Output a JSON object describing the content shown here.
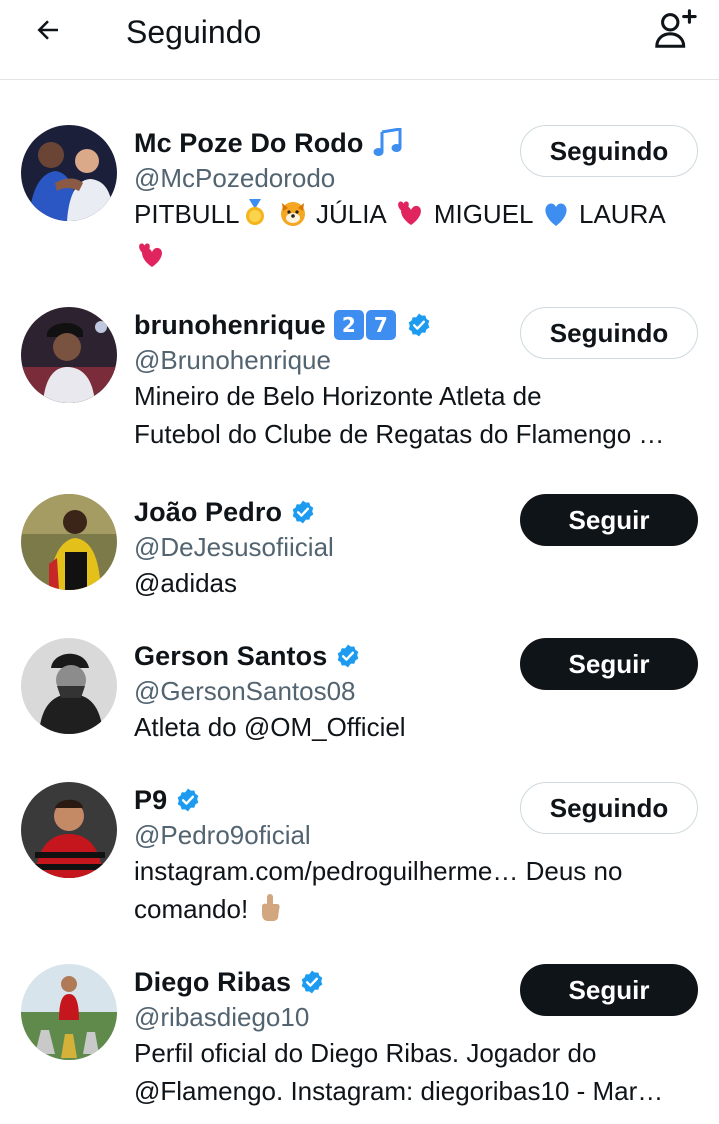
{
  "header": {
    "title": "Seguindo",
    "back_icon": "arrow-left-icon",
    "add_icon": "add-user-icon"
  },
  "users": [
    {
      "name": "Mc Poze Do Rodo",
      "name_emoji": "musical-notes-emoji",
      "handle": "@McPozedorodo",
      "bio_line1_a": "PITBULL",
      "bio_line1_b": "JÚLIA",
      "bio_line1_c": "MIGUEL",
      "bio_line1_d": "LAURA",
      "button": "Seguindo",
      "following": true
    },
    {
      "name": "brunohenrique",
      "name_digits": [
        "2",
        "7"
      ],
      "verified": true,
      "handle": "@Brunohenrique",
      "bio_line1": "Mineiro de Belo Horizonte Atleta de",
      "bio_line2": "Futebol do Clube de Regatas do Flamengo …",
      "button": "Seguindo",
      "following": true
    },
    {
      "name": "João Pedro",
      "verified": true,
      "handle": "@DeJesusofiicial",
      "bio_line1": "@adidas",
      "button": "Seguir",
      "following": false
    },
    {
      "name": "Gerson Santos",
      "verified": true,
      "handle": "@GersonSantos08",
      "bio_line1": "Atleta do @OM_Officiel",
      "button": "Seguir",
      "following": false
    },
    {
      "name": "P9",
      "verified": true,
      "handle": "@Pedro9oficial",
      "bio_line1": "instagram.com/pedroguilherme… Deus no",
      "bio_line2": "comando!",
      "button": "Seguindo",
      "following": true
    },
    {
      "name": "Diego Ribas",
      "verified": true,
      "handle": "@ribasdiego10",
      "bio_line1": "Perfil oficial do Diego Ribas. Jogador do",
      "bio_line2": "@Flamengo. Instagram: diegoribas10 - Mar…",
      "button": "Seguir",
      "following": false
    }
  ],
  "colors": {
    "text_primary": "#0f1419",
    "text_secondary": "#536471",
    "verified_blue": "#1d9bf0",
    "border": "#cfd9de"
  }
}
